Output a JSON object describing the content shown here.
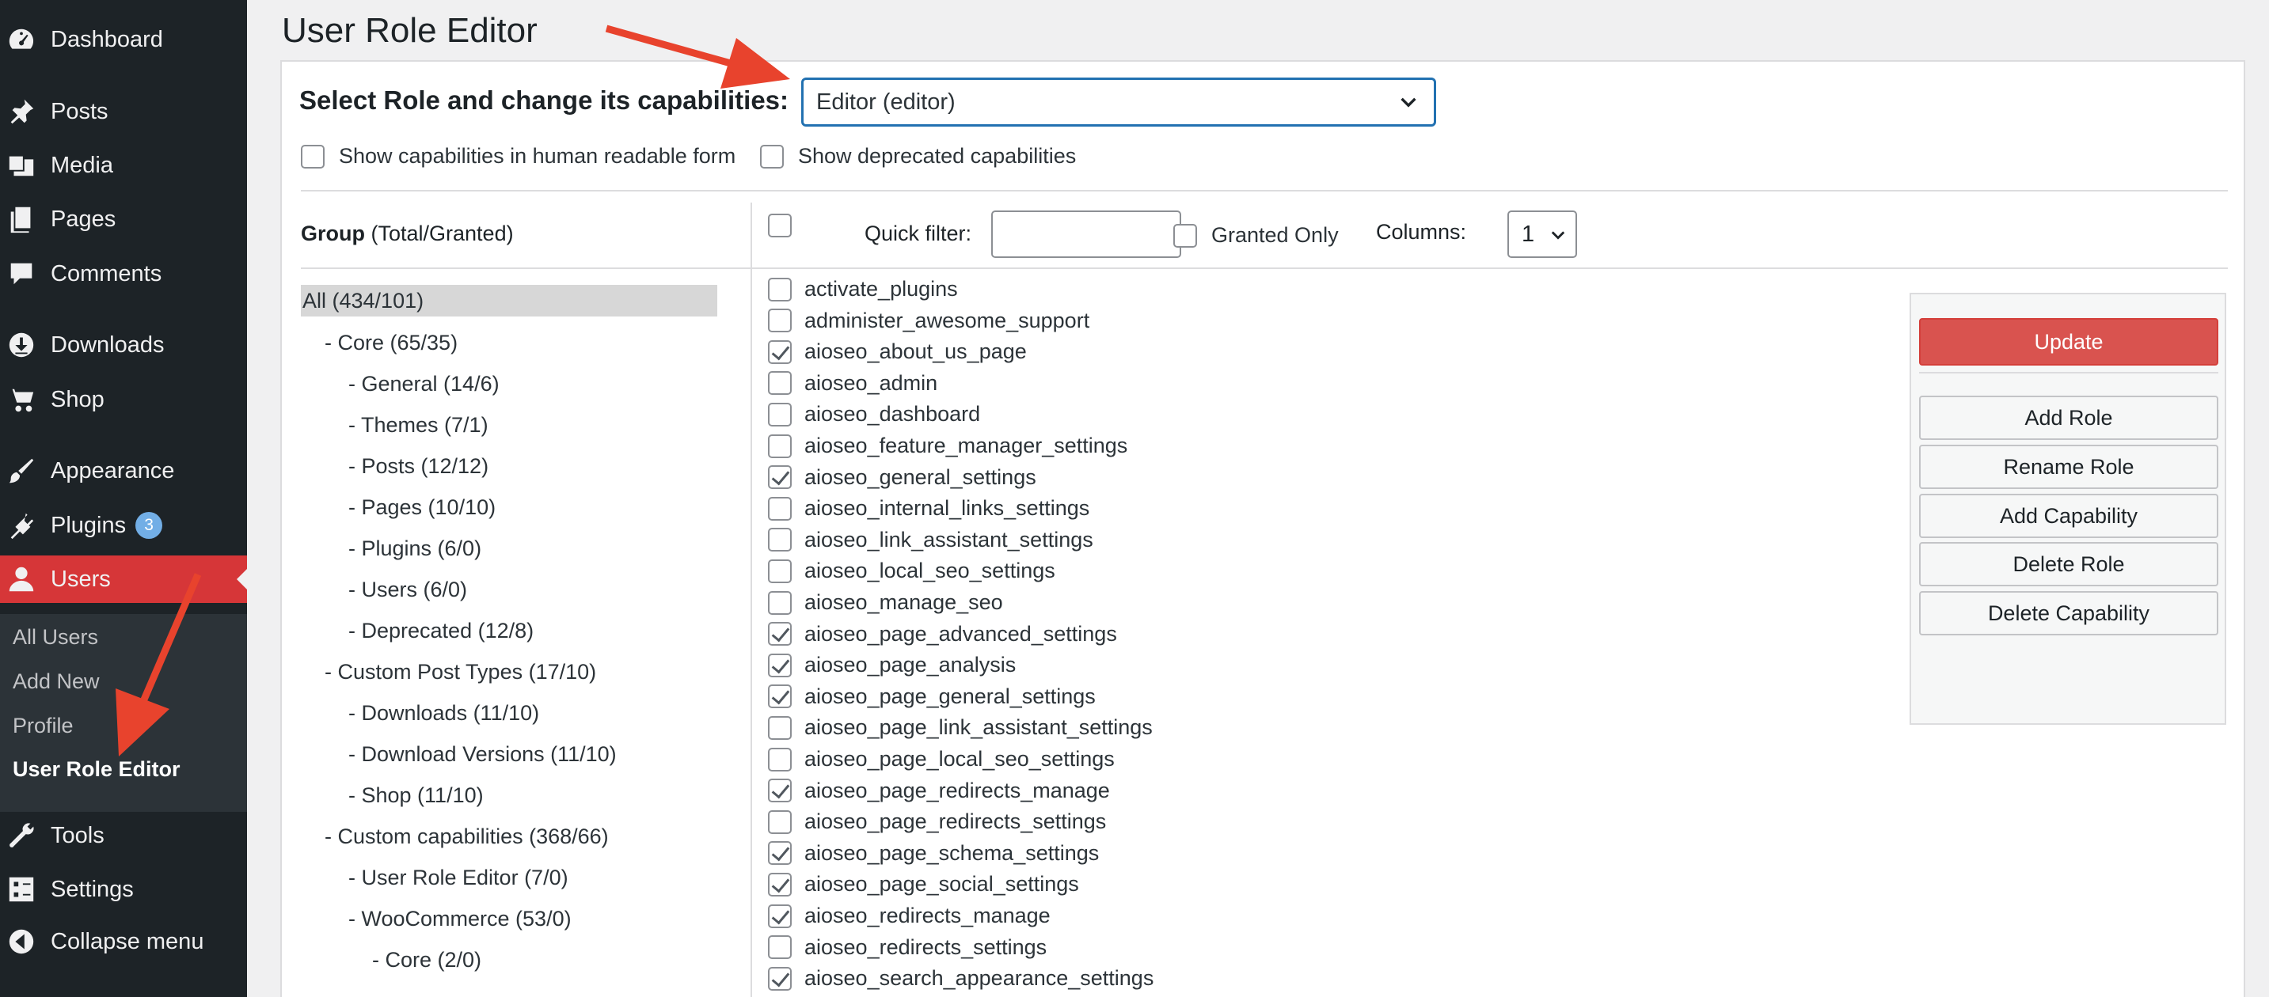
{
  "sidebar": {
    "items": [
      {
        "label": "Dashboard",
        "icon": "dashboard-icon"
      },
      {
        "label": "Posts",
        "icon": "pin-icon"
      },
      {
        "label": "Media",
        "icon": "media-icon"
      },
      {
        "label": "Pages",
        "icon": "pages-icon"
      },
      {
        "label": "Comments",
        "icon": "comment-icon"
      },
      {
        "label": "Downloads",
        "icon": "download-icon"
      },
      {
        "label": "Shop",
        "icon": "cart-icon"
      },
      {
        "label": "Appearance",
        "icon": "brush-icon"
      },
      {
        "label": "Plugins",
        "icon": "plug-icon",
        "badge": "3"
      },
      {
        "label": "Users",
        "icon": "user-icon",
        "active": true
      },
      {
        "label": "Tools",
        "icon": "wrench-icon"
      },
      {
        "label": "Settings",
        "icon": "settings-icon"
      },
      {
        "label": "Collapse menu",
        "icon": "collapse-icon"
      }
    ],
    "users_submenu": [
      "All Users",
      "Add New",
      "Profile",
      "User Role Editor"
    ],
    "colors": {
      "background": "#1d2327",
      "active": "#d63638",
      "submenu": "#2c3338",
      "badge": "#72aee6"
    }
  },
  "page": {
    "title": "User Role Editor",
    "select_label": "Select Role and change its capabilities:",
    "selected_role": "Editor (editor)",
    "show_human_readable": "Show capabilities in human readable form",
    "show_deprecated": "Show deprecated capabilities",
    "group_header_bold": "Group",
    "group_header_rest": " (Total/Granted)",
    "quick_filter_label": "Quick filter:",
    "quick_filter_value": "",
    "granted_only_label": "Granted Only",
    "columns_label": "Columns:",
    "columns_value": "1"
  },
  "groups": [
    {
      "label": "All (434/101)",
      "selected": true
    },
    {
      "label": "- Core (65/35)"
    },
    {
      "label": "- General (14/6)"
    },
    {
      "label": "- Themes (7/1)"
    },
    {
      "label": "- Posts (12/12)"
    },
    {
      "label": "- Pages (10/10)"
    },
    {
      "label": "- Plugins (6/0)"
    },
    {
      "label": "- Users (6/0)"
    },
    {
      "label": "- Deprecated (12/8)"
    },
    {
      "label": "- Custom Post Types (17/10)"
    },
    {
      "label": "- Downloads (11/10)"
    },
    {
      "label": "- Download Versions (11/10)"
    },
    {
      "label": "- Shop (11/10)"
    },
    {
      "label": "- Custom capabilities (368/66)"
    },
    {
      "label": "- User Role Editor (7/0)"
    },
    {
      "label": "- WooCommerce (53/0)"
    },
    {
      "label": "- Core (2/0)"
    }
  ],
  "capabilities": [
    {
      "name": "activate_plugins",
      "checked": false
    },
    {
      "name": "administer_awesome_support",
      "checked": false
    },
    {
      "name": "aioseo_about_us_page",
      "checked": true
    },
    {
      "name": "aioseo_admin",
      "checked": false
    },
    {
      "name": "aioseo_dashboard",
      "checked": false
    },
    {
      "name": "aioseo_feature_manager_settings",
      "checked": false
    },
    {
      "name": "aioseo_general_settings",
      "checked": true
    },
    {
      "name": "aioseo_internal_links_settings",
      "checked": false
    },
    {
      "name": "aioseo_link_assistant_settings",
      "checked": false
    },
    {
      "name": "aioseo_local_seo_settings",
      "checked": false
    },
    {
      "name": "aioseo_manage_seo",
      "checked": false
    },
    {
      "name": "aioseo_page_advanced_settings",
      "checked": true
    },
    {
      "name": "aioseo_page_analysis",
      "checked": true
    },
    {
      "name": "aioseo_page_general_settings",
      "checked": true
    },
    {
      "name": "aioseo_page_link_assistant_settings",
      "checked": false
    },
    {
      "name": "aioseo_page_local_seo_settings",
      "checked": false
    },
    {
      "name": "aioseo_page_redirects_manage",
      "checked": true
    },
    {
      "name": "aioseo_page_redirects_settings",
      "checked": false
    },
    {
      "name": "aioseo_page_schema_settings",
      "checked": true
    },
    {
      "name": "aioseo_page_social_settings",
      "checked": true
    },
    {
      "name": "aioseo_redirects_manage",
      "checked": true
    },
    {
      "name": "aioseo_redirects_settings",
      "checked": false
    },
    {
      "name": "aioseo_search_appearance_settings",
      "checked": true
    }
  ],
  "actions": {
    "update": "Update",
    "add_role": "Add Role",
    "rename_role": "Rename Role",
    "add_capability": "Add Capability",
    "delete_role": "Delete Role",
    "delete_capability": "Delete Capability",
    "update_color": "#d9534f"
  },
  "annotation_color": "#e8432d"
}
